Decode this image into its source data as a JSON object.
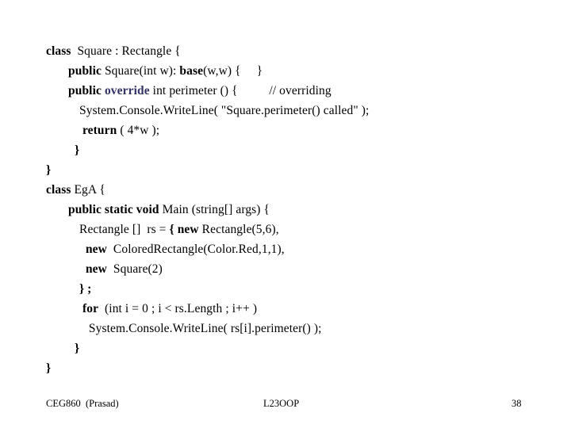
{
  "slide": {
    "background_color": "#ffffff",
    "text_color": "#000000",
    "keyword_color": "#333366",
    "code_lines": [
      {
        "indent": "ind1",
        "segments": [
          {
            "text": "class",
            "style": "kw"
          },
          {
            "text": "  Square : Rectangle {",
            "style": "plain"
          }
        ]
      },
      {
        "indent": "ind2",
        "segments": [
          {
            "text": "public",
            "style": "kw"
          },
          {
            "text": " Square(int w): ",
            "style": "plain"
          },
          {
            "text": "base",
            "style": "kw"
          },
          {
            "text": "(w,w) {     }",
            "style": "plain"
          }
        ]
      },
      {
        "indent": "ind2",
        "segments": [
          {
            "text": "public",
            "style": "kw"
          },
          {
            "text": " ",
            "style": "plain"
          },
          {
            "text": "override",
            "style": "kw-override"
          },
          {
            "text": " int perimeter () {          ",
            "style": "plain"
          },
          {
            "text": "// overriding",
            "style": "cmt"
          }
        ]
      },
      {
        "indent": "ind3",
        "segments": [
          {
            "text": "System.Console.Write",
            "style": "plain"
          },
          {
            "text": "Line",
            "style": "plain"
          },
          {
            "text": "( \"Square.perimeter() called\" );",
            "style": "plain"
          }
        ]
      },
      {
        "indent": "ind3",
        "segments": [
          {
            "text": " ",
            "style": "plain"
          },
          {
            "text": "return",
            "style": "kw"
          },
          {
            "text": " ( 4*w );",
            "style": "plain"
          }
        ]
      },
      {
        "indent": "ind2",
        "segments": [
          {
            "text": "  }",
            "style": "kw"
          }
        ]
      },
      {
        "indent": "ind1",
        "segments": [
          {
            "text": "}",
            "style": "kw"
          }
        ]
      },
      {
        "indent": "ind1",
        "segments": [
          {
            "text": "class",
            "style": "kw"
          },
          {
            "text": " Eg",
            "style": "plain"
          },
          {
            "text": "A {",
            "style": "plain"
          }
        ]
      },
      {
        "indent": "ind2",
        "segments": [
          {
            "text": "public static void",
            "style": "kw"
          },
          {
            "text": " Main (string[] args) {",
            "style": "plain"
          }
        ]
      },
      {
        "indent": "ind3",
        "segments": [
          {
            "text": "Rectangle []  rs = ",
            "style": "plain"
          },
          {
            "text": "{ new",
            "style": "kw"
          },
          {
            "text": " Rectangle(5,6),",
            "style": "plain"
          }
        ]
      },
      {
        "indent": "ind3",
        "segments": [
          {
            "text": "  new",
            "style": "kw"
          },
          {
            "text": "  ColoredRectangle(Color.Red,1,1),",
            "style": "plain"
          }
        ]
      },
      {
        "indent": "ind3",
        "segments": [
          {
            "text": "  new",
            "style": "kw"
          },
          {
            "text": "  Square(2)",
            "style": "plain"
          }
        ]
      },
      {
        "indent": "ind3",
        "segments": [
          {
            "text": "} ;",
            "style": "kw"
          }
        ]
      },
      {
        "indent": "ind3",
        "segments": [
          {
            "text": " for",
            "style": "kw"
          },
          {
            "text": "  (int i = 0 ; i < rs.Length ; i++ )",
            "style": "plain"
          }
        ]
      },
      {
        "indent": "ind3",
        "segments": [
          {
            "text": "   System.Console.WriteLine( rs[i].perimeter() );",
            "style": "plain"
          }
        ]
      },
      {
        "indent": "ind2",
        "segments": [
          {
            "text": "  }",
            "style": "kw"
          }
        ]
      },
      {
        "indent": "ind1",
        "segments": [
          {
            "text": "}",
            "style": "kw"
          }
        ]
      }
    ]
  },
  "footer": {
    "left": "CEG860  (Prasad)",
    "center": "L23OOP",
    "right": "38"
  }
}
